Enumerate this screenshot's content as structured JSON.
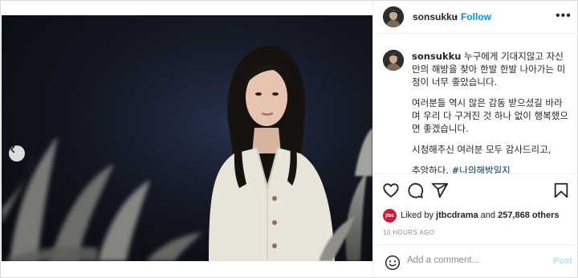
{
  "post": {
    "username": "sonsukku",
    "separator": "•",
    "follow_label": "Follow",
    "more_label": "•••"
  },
  "caption": {
    "username": "sonsukku",
    "paragraphs": [
      "누구에게 기대지않고 자신만의 해방을 찾아 한발 한발 나아가는 미정이 너무 좋았습니다.",
      "여러분들 역시 많은 감동 받으셨길 바라며 우리 다 구겨진 것 하나 없이 행복했으면 좋겠습니다.",
      "시청해주신 여러분 모두 감사드리고,"
    ],
    "last_text": "추앙하다. ",
    "hashtag": "#나의해방일지"
  },
  "likes": {
    "badge": "jtbc",
    "prefix": "Liked by ",
    "account": "jtbcdrama",
    "middle": " and ",
    "count": "257,868 others"
  },
  "timestamp": "10 HOURS AGO",
  "comment": {
    "placeholder": "Add a comment...",
    "post_label": "Post"
  },
  "carousel": {
    "slide_count": 6,
    "active_index": 5
  },
  "icons": {
    "like": "heart-icon",
    "comment": "comment-icon",
    "share": "share-icon",
    "save": "bookmark-icon",
    "emoji": "smiley-icon",
    "prev": "chevron-left-icon"
  },
  "colors": {
    "follow": "#0095f6",
    "hashtag": "#00376b",
    "post_disabled": "#b2dffc",
    "jtbc_badge": "#c81e3c"
  }
}
